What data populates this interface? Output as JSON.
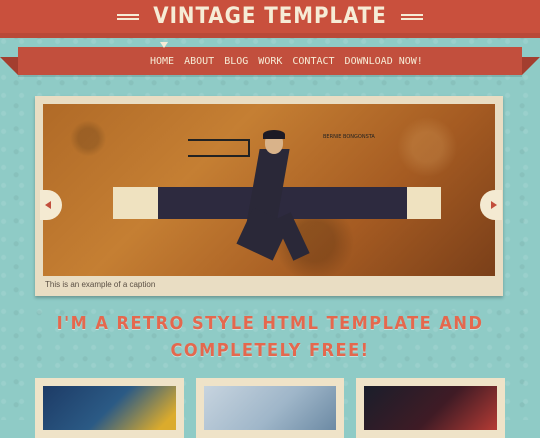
{
  "header": {
    "logo_text": "VINTAGE TEMPLATE",
    "nav": [
      "HOME",
      "ABOUT",
      "BLOG",
      "WORK",
      "CONTACT",
      "DOWNLOAD NOW!"
    ]
  },
  "slider": {
    "caption": "This is an example of a caption",
    "tiny_text": "BERNIE BONGONSTA"
  },
  "tagline": {
    "line1": "I'M A RETRO STYLE HTML TEMPLATE AND",
    "line2": "COMPLETELY FREE!"
  },
  "colors": {
    "background": "#8fcbc6",
    "header": "#c9503d",
    "ribbon": "#c24f3d",
    "tagline": "#e4684e",
    "panel": "#e9ddc3"
  }
}
